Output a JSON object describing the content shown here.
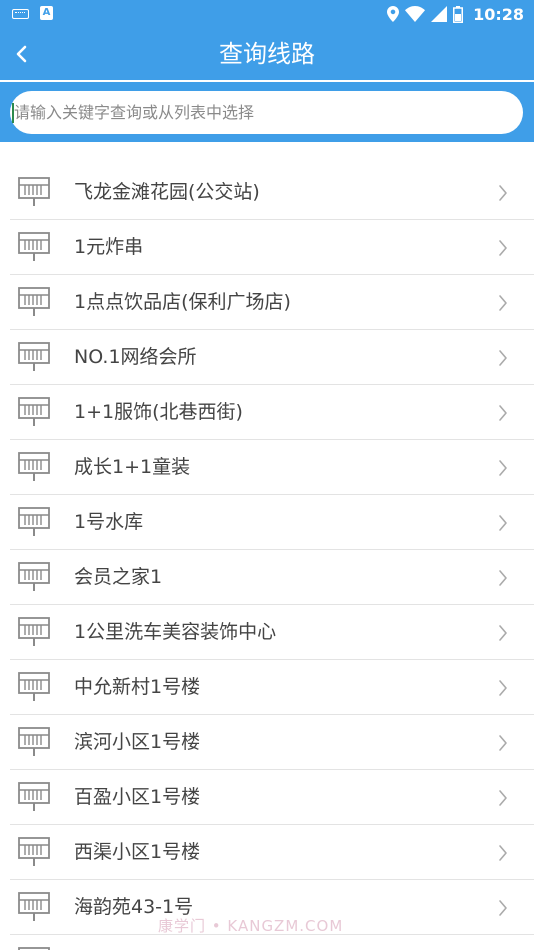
{
  "status_bar": {
    "time": "10:28",
    "icons": [
      "keyboard-icon",
      "a-notification-icon",
      "location-icon",
      "wifi-icon",
      "signal-icon",
      "battery-icon"
    ]
  },
  "header": {
    "title": "查询线路"
  },
  "search": {
    "placeholder": "请输入关键字查询或从列表中选择",
    "value": ""
  },
  "colors": {
    "primary": "#3f9ee8",
    "text": "#444444",
    "divider": "#e3e3e3",
    "icon": "#8a8a8a"
  },
  "list": {
    "items": [
      {
        "label": "飞龙金滩花园(公交站)"
      },
      {
        "label": "1元炸串"
      },
      {
        "label": "1点点饮品店(保利广场店)"
      },
      {
        "label": "NO.1网络会所"
      },
      {
        "label": "1+1服饰(北巷西街)"
      },
      {
        "label": "成长1+1童装"
      },
      {
        "label": "1号水库"
      },
      {
        "label": "会员之家1"
      },
      {
        "label": "1公里洗车美容装饰中心"
      },
      {
        "label": "中允新村1号楼"
      },
      {
        "label": "滨河小区1号楼"
      },
      {
        "label": "百盈小区1号楼"
      },
      {
        "label": "西渠小区1号楼"
      },
      {
        "label": "海韵苑43-1号"
      },
      {
        "label": ""
      }
    ]
  },
  "watermark": "康学门 • KANGZM.COM"
}
